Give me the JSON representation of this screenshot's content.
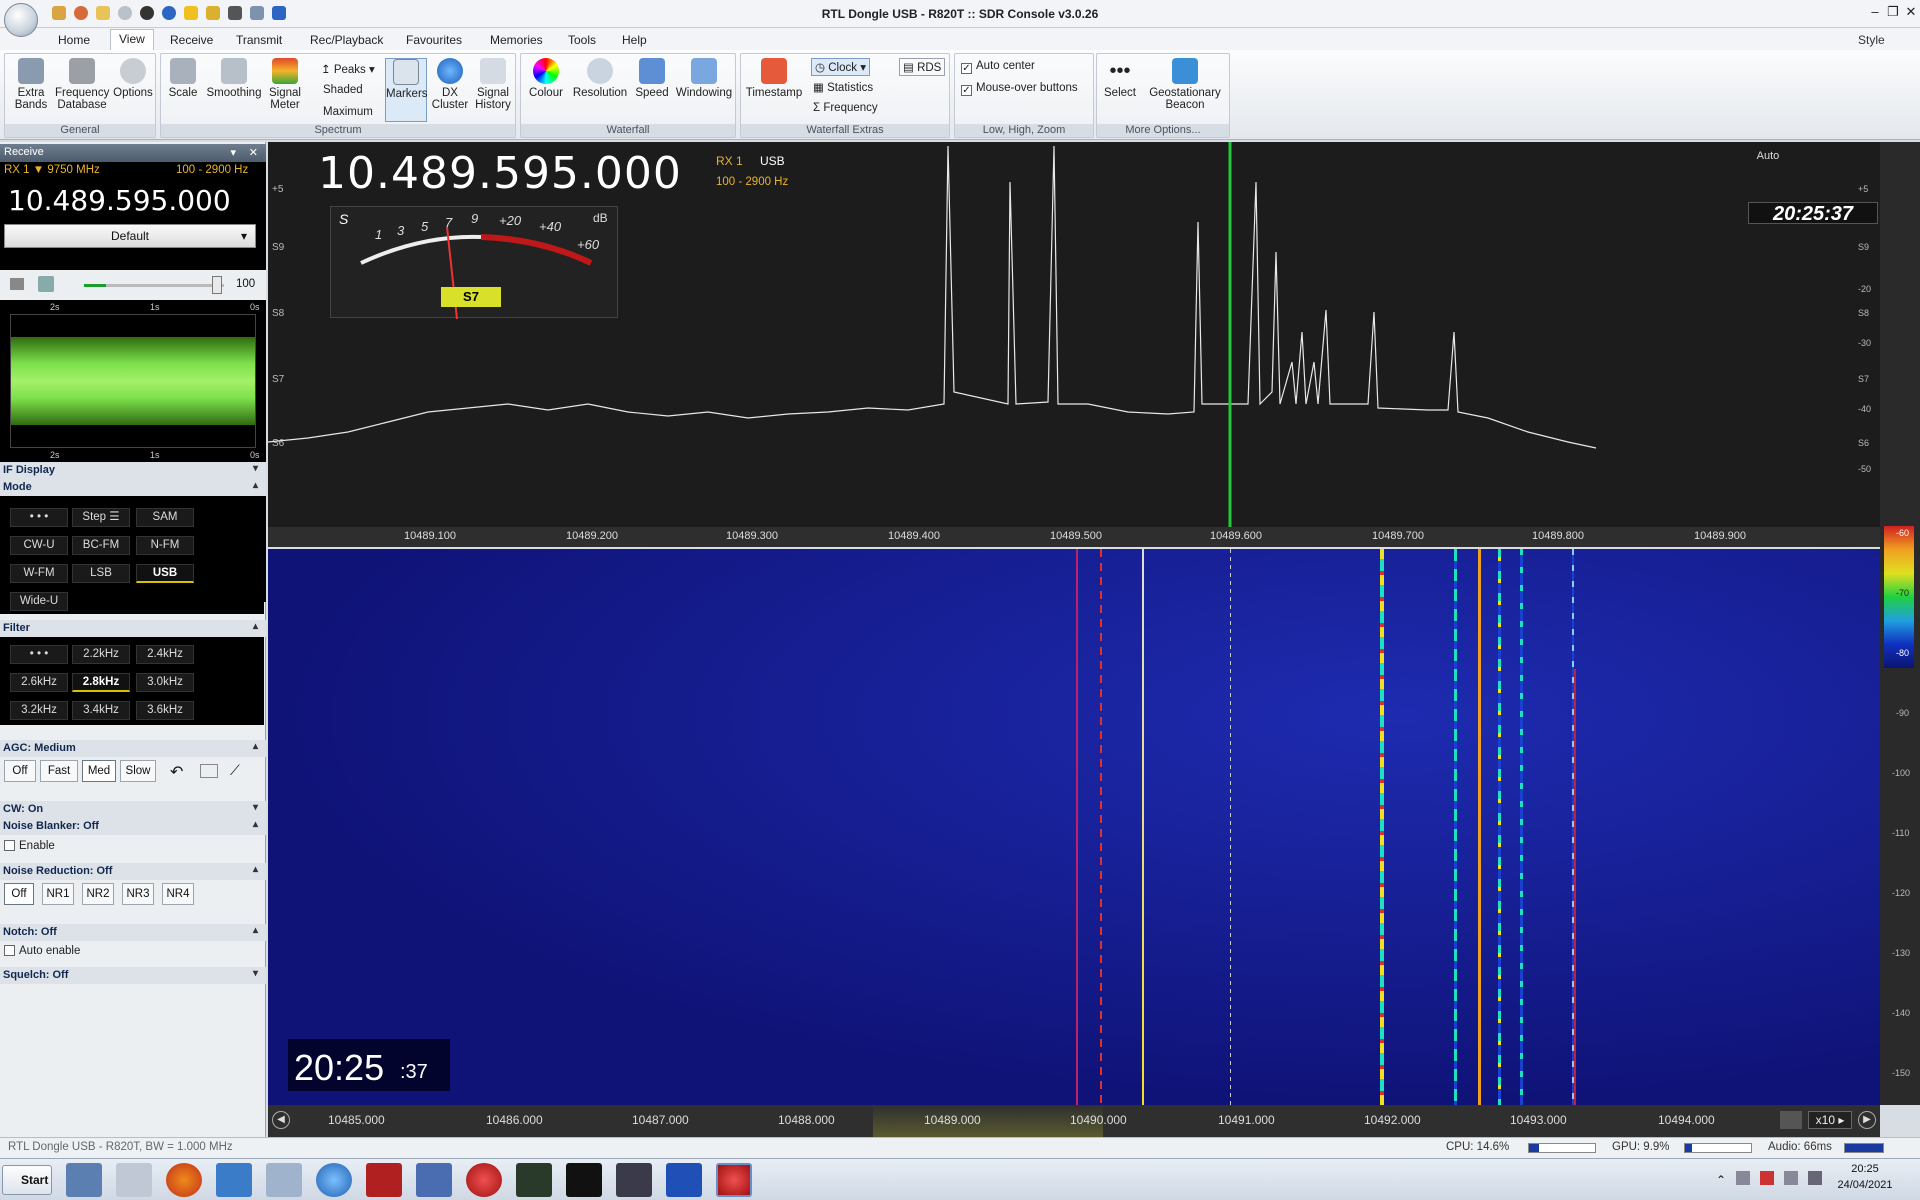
{
  "window": {
    "title": "RTL Dongle USB - R820T :: SDR Console v3.0.26",
    "style_label": "Style"
  },
  "menu": [
    "Home",
    "View",
    "Receive",
    "Transmit",
    "Rec/Playback",
    "Favourites",
    "Memories",
    "Tools",
    "Help"
  ],
  "ribbon": {
    "general": {
      "label": "General",
      "buttons": [
        {
          "label": "Extra\nBands",
          "icon": "bands-icon"
        },
        {
          "label": "Frequency\nDatabase",
          "icon": "database-icon"
        },
        {
          "label": "Options",
          "icon": "gear-icon"
        }
      ]
    },
    "spectrum": {
      "label": "Spectrum",
      "scale": "Scale",
      "smoothing": "Smoothing",
      "signal_meter": "Signal\nMeter",
      "peaks": "Peaks",
      "shaded": "Shaded",
      "maximum": "Maximum",
      "markers": "Markers",
      "dx_cluster": "DX\nCluster",
      "signal_history": "Signal\nHistory"
    },
    "waterfall": {
      "label": "Waterfall",
      "colour": "Colour",
      "resolution": "Resolution",
      "speed": "Speed",
      "windowing": "Windowing"
    },
    "waterfall_extras": {
      "label": "Waterfall Extras",
      "timestamp": "Timestamp",
      "clock": "Clock",
      "statistics": "Statistics",
      "frequency": "Frequency",
      "rds": "RDS"
    },
    "zoom": {
      "label": "Low, High, Zoom",
      "auto_center": "Auto center",
      "mouse_over": "Mouse-over buttons"
    },
    "more": {
      "label": "More Options...",
      "select": "Select",
      "geo": "Geostationary\nBeacon"
    }
  },
  "receive": {
    "header": "Receive",
    "rx": "RX 1",
    "lo": "▼ 9750 MHz",
    "bw": "100 - 2900 Hz",
    "frequency": "10.489.595.000",
    "preset": "Default",
    "volume": "100",
    "scope_ticks_top": [
      "2s",
      "1s",
      "0s"
    ],
    "scope_ticks_bottom": [
      "2s",
      "1s",
      "0s"
    ]
  },
  "if_display": "IF Display",
  "mode": {
    "header": "Mode",
    "buttons": [
      "• • •",
      "Step ☰",
      "SAM",
      "CW-U",
      "BC-FM",
      "N-FM",
      "W-FM",
      "LSB",
      "USB",
      "Wide-U"
    ],
    "selected": "USB"
  },
  "filter": {
    "header": "Filter",
    "buttons": [
      "• • •",
      "2.2kHz",
      "2.4kHz",
      "2.6kHz",
      "2.8kHz",
      "3.0kHz",
      "3.2kHz",
      "3.4kHz",
      "3.6kHz"
    ],
    "selected": "2.8kHz"
  },
  "agc": {
    "header": "AGC: Medium",
    "buttons": [
      "Off",
      "Fast",
      "Med",
      "Slow"
    ],
    "selected": "Med"
  },
  "cw": "CW: On",
  "noise_blanker": {
    "header": "Noise Blanker: Off",
    "enable": "Enable"
  },
  "noise_reduction": {
    "header": "Noise Reduction: Off",
    "buttons": [
      "Off",
      "NR1",
      "NR2",
      "NR3",
      "NR4"
    ],
    "selected": "Off"
  },
  "notch": {
    "header": "Notch: Off",
    "auto": "Auto enable"
  },
  "squelch": "Squelch: Off",
  "spectrum": {
    "frequency": "10.489.595.000",
    "rx": "RX 1",
    "mode": "USB",
    "bw": "100 - 2900 Hz",
    "meter_reading": "S7",
    "meter_labels": [
      "S",
      "1",
      "3",
      "5",
      "7",
      "9",
      "+20",
      "+40",
      "+60",
      "dB"
    ],
    "s_labels": [
      "+5",
      "S9",
      "S8",
      "S7",
      "S6"
    ],
    "db_labels": [
      "+5",
      "S9",
      "-20",
      "S8",
      "-30",
      "S7",
      "-40",
      "S6",
      "-50"
    ],
    "auto": "Auto",
    "clock": "20:25:37",
    "axis": [
      "10489.100",
      "10489.200",
      "10489.300",
      "10489.400",
      "10489.500",
      "10489.600",
      "10489.700",
      "10489.800",
      "10489.900"
    ]
  },
  "waterfall": {
    "clock_main": "20:25",
    "clock_sec": ":37",
    "axis": [
      "10485.000",
      "10486.000",
      "10487.000",
      "10488.000",
      "10489.000",
      "10490.000",
      "10491.000",
      "10492.000",
      "10493.000",
      "10494.000"
    ],
    "zoom": "x10",
    "scale": [
      "-60",
      "-70",
      "-80",
      "-90",
      "-100",
      "-110",
      "-120",
      "-130",
      "-140",
      "-150"
    ]
  },
  "status": {
    "device": "RTL Dongle USB - R820T, BW = 1.000 MHz",
    "cpu": "CPU: 14.6%",
    "gpu": "GPU: 9.9%",
    "audio": "Audio: 66ms"
  },
  "taskbar": {
    "start": "Start",
    "time": "20:25",
    "date": "24/04/2021"
  },
  "colors": {
    "accent_green": "#22c83a",
    "meter_red": "#c01818",
    "spectrum_bg": "#1c1c1c",
    "waterfall_bg": "#12148a"
  }
}
